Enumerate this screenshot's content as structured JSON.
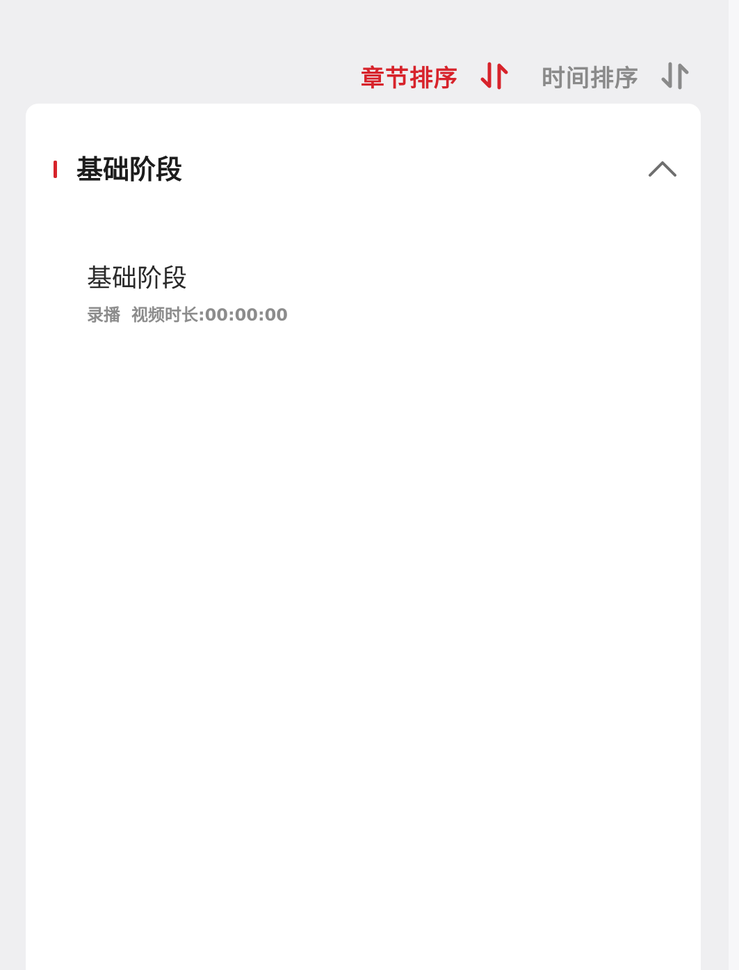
{
  "colors": {
    "accent": "#d7232b",
    "inactive": "#8a8a8a",
    "background": "#efeff1",
    "card": "#ffffff"
  },
  "sort_bar": {
    "options": [
      {
        "label": "章节排序",
        "icon": "sort-arrows-icon",
        "active": true
      },
      {
        "label": "时间排序",
        "icon": "sort-arrows-icon",
        "active": false
      }
    ]
  },
  "section": {
    "title": "基础阶段",
    "expanded": true,
    "toggle_icon": "chevron-up-icon",
    "lessons": [
      {
        "title": "基础阶段",
        "type": "录播",
        "duration": "视频时长:00:00:00"
      }
    ]
  }
}
